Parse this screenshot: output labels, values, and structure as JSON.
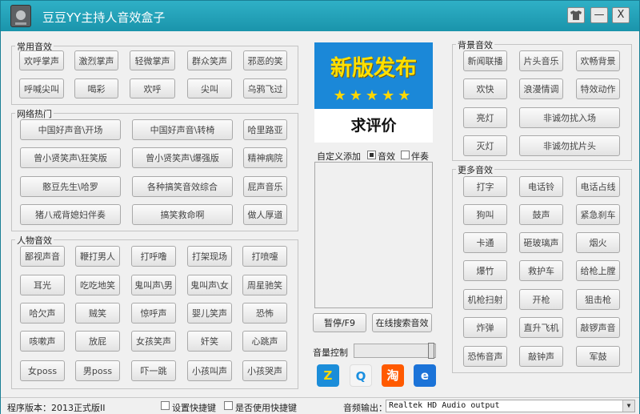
{
  "window": {
    "title": "豆豆YY主持人音效盒子"
  },
  "titlebar_buttons": [
    "—",
    "X"
  ],
  "common": {
    "title": "常用音效",
    "buttons": [
      "欢呼掌声",
      "激烈掌声",
      "轻微掌声",
      "群众笑声",
      "邪恶的笑",
      "呼喊尖叫",
      "喝彩",
      "欢呼",
      "尖叫",
      "乌鸦飞过"
    ]
  },
  "network": {
    "title": "网络热门",
    "buttons": [
      "中国好声音\\开场",
      "中国好声音\\转椅",
      "哈里路亚",
      "曾小贤笑声\\狂笑版",
      "曾小贤笑声\\爆强版",
      "精神病院",
      "憨豆先生\\哈罗",
      "各种搞笑音效综合",
      "屁声音乐",
      "猪八戒背媳妇伴奏",
      "搞笑救命啊",
      "做人厚道"
    ]
  },
  "people": {
    "title": "人物音效",
    "buttons": [
      "鄙视声音",
      "鞭打男人",
      "打呼噜",
      "打架现场",
      "打喷嚏",
      "耳光",
      "吃吃地笑",
      "鬼叫声\\男",
      "鬼叫声\\女",
      "周星驰笑",
      "哈欠声",
      "贼笑",
      "惊呼声",
      "婴儿笑声",
      "恐怖",
      "咳嗽声",
      "放屁",
      "女孩笑声",
      "奸笑",
      "心跳声",
      "女poss",
      "男poss",
      "吓一跳",
      "小孩叫声",
      "小孩哭声"
    ]
  },
  "promo": {
    "top": "新版发布",
    "stars": "★★★★★",
    "bottom": "求评价"
  },
  "custom": {
    "label": "自定义添加",
    "opt_sound": "音效",
    "opt_accomp": "伴奏"
  },
  "controls": {
    "pause": "暂停/F9",
    "search": "在线搜索音效",
    "volume_label": "音量控制",
    "volume_level": 0.98
  },
  "bottom_icons": [
    "Z",
    "Q",
    "淘",
    "e"
  ],
  "background": {
    "title": "背景音效",
    "buttons": [
      "新闻联播",
      "片头音乐",
      "欢畅背景",
      "欢快",
      "浪漫情调",
      "特效动作",
      "亮灯",
      "非诚勿扰入场",
      "灭灯",
      "非诚勿扰片头"
    ]
  },
  "more": {
    "title": "更多音效",
    "buttons": [
      "打字",
      "电话铃",
      "电话占线",
      "狗叫",
      "鼓声",
      "紧急刹车",
      "卡通",
      "砸玻璃声",
      "烟火",
      "爆竹",
      "救护车",
      "给枪上膛",
      "机枪扫射",
      "开枪",
      "狙击枪",
      "炸弹",
      "直升飞机",
      "敲锣声音",
      "恐怖音声",
      "敲钟声",
      "军鼓"
    ]
  },
  "status": {
    "version": "程序版本：2013正式版II",
    "set_hotkey": "设置快捷键",
    "use_hotkey": "是否使用快捷键",
    "output_label": "音频输出：",
    "output_value": "Realtek HD Audio output"
  }
}
